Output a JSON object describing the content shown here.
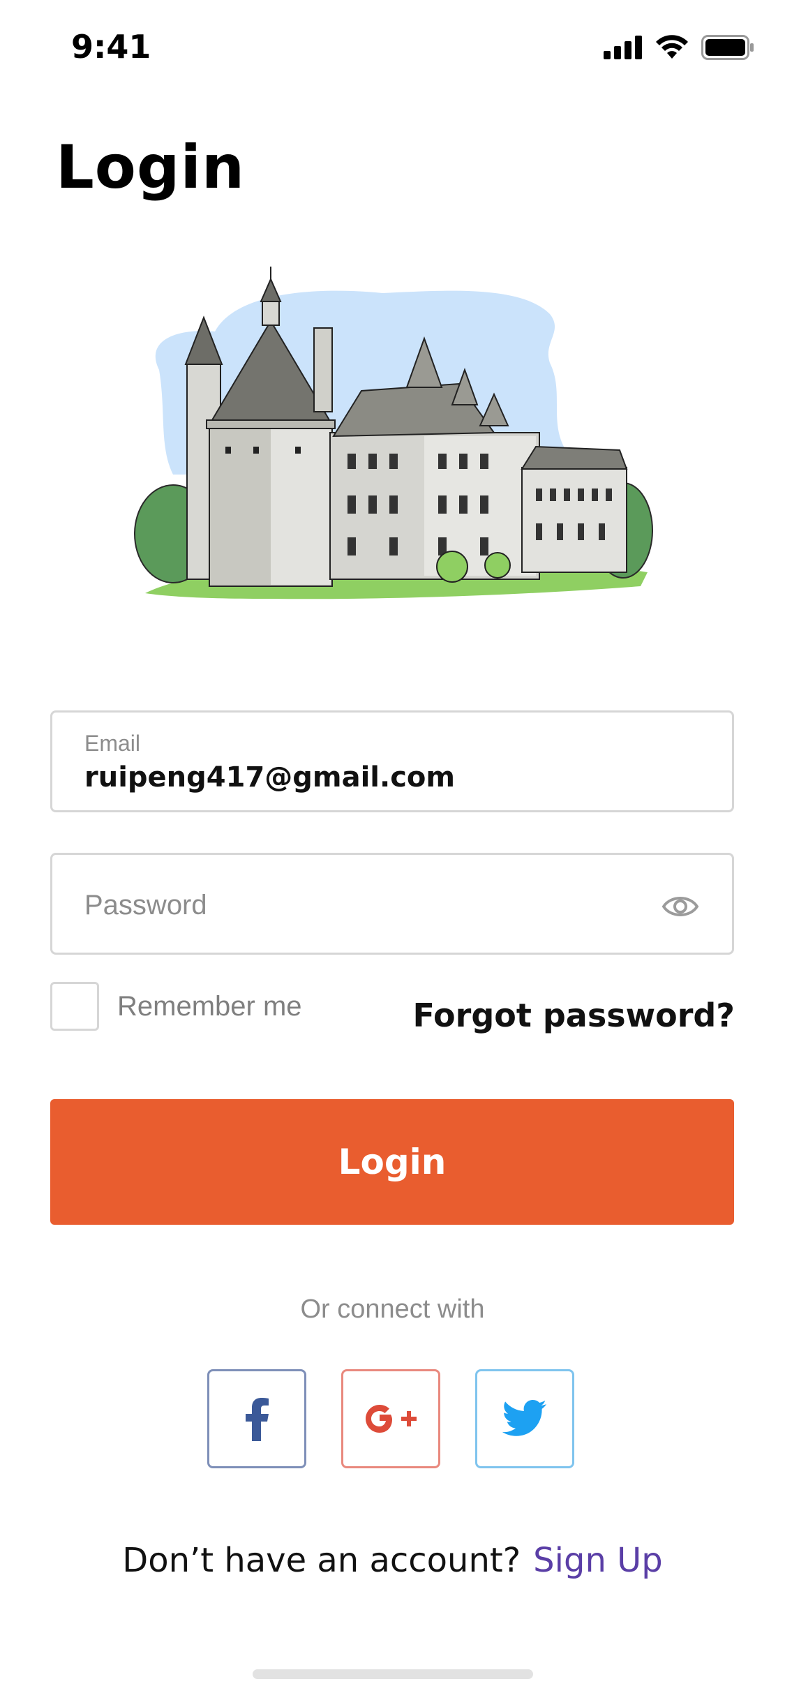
{
  "status_bar": {
    "time": "9:41"
  },
  "page": {
    "title": "Login"
  },
  "form": {
    "email": {
      "label": "Email",
      "value": "ruipeng417@gmail.com"
    },
    "password": {
      "placeholder": "Password"
    },
    "remember_label": "Remember me",
    "forgot_label": "Forgot password?",
    "login_label": "Login"
  },
  "social": {
    "caption": "Or connect with",
    "providers": [
      {
        "name": "facebook",
        "icon": "facebook-icon",
        "color": "#3b5998"
      },
      {
        "name": "google-plus",
        "icon": "google-plus-icon",
        "color": "#dd4b39"
      },
      {
        "name": "twitter",
        "icon": "twitter-icon",
        "color": "#1da1f2"
      }
    ]
  },
  "footer": {
    "prompt": "Don’t have an account?",
    "signup_label": "Sign Up"
  },
  "colors": {
    "accent": "#e95d2f",
    "link": "#5a3ea6",
    "border": "#d6d6d6"
  }
}
